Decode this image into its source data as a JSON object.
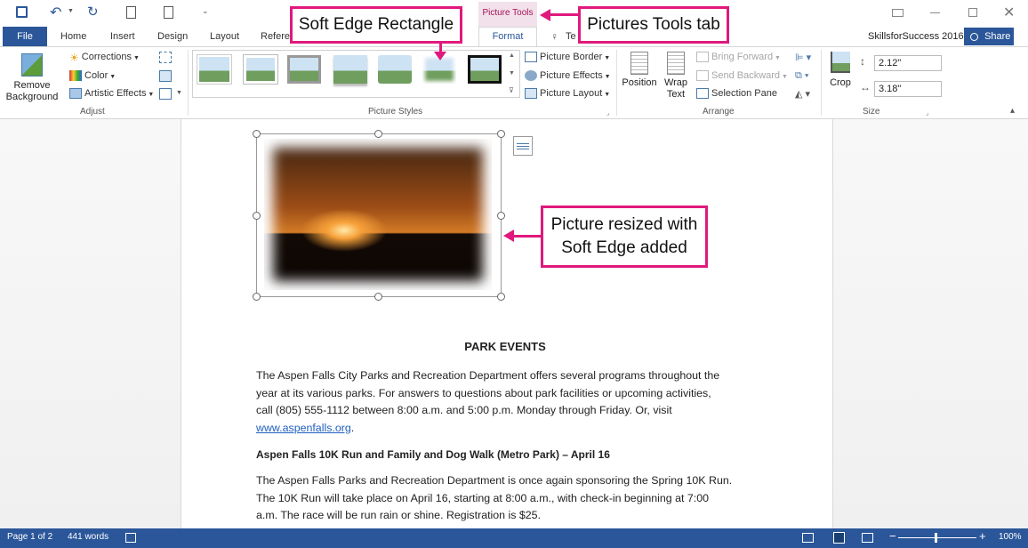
{
  "titlebar": {
    "account": "SkillsforSuccess 2016",
    "share": "Share"
  },
  "tabs": {
    "file": "File",
    "home": "Home",
    "insert": "Insert",
    "design": "Design",
    "layout": "Layout",
    "references": "Refere",
    "format": "Format",
    "tell": "Te",
    "picture_tools": "Picture Tools"
  },
  "ribbon": {
    "adjust": {
      "remove_background_1": "Remove",
      "remove_background_2": "Background",
      "corrections": "Corrections",
      "color": "Color",
      "artistic_effects": "Artistic Effects",
      "label": "Adjust"
    },
    "picture_styles": {
      "border": "Picture Border",
      "effects": "Picture Effects",
      "layout": "Picture Layout",
      "label": "Picture Styles"
    },
    "arrange": {
      "position": "Position",
      "wrap_text_1": "Wrap",
      "wrap_text_2": "Text",
      "bring_forward": "Bring Forward",
      "send_backward": "Send Backward",
      "selection_pane": "Selection Pane",
      "label": "Arrange"
    },
    "size": {
      "crop": "Crop",
      "height": "2.12\"",
      "width": "3.18\"",
      "label": "Size"
    }
  },
  "callouts": {
    "soft_edge": "Soft Edge Rectangle",
    "pictures_tools": "Pictures Tools tab",
    "resized_1": "Picture resized with",
    "resized_2": "Soft Edge added"
  },
  "document": {
    "heading": "PARK EVENTS",
    "para1_l1": "The Aspen Falls City Parks and Recreation Department offers several programs throughout the",
    "para1_l2": "year at its various parks. For answers to questions about park facilities or upcoming activities,",
    "para1_l3": "call (805) 555-1112 between 8:00 a.m. and 5:00 p.m. Monday through Friday. Or, visit",
    "link": "www.aspenfalls.org",
    "link_after": ".",
    "subheading": "Aspen Falls 10K Run and Family and Dog Walk (Metro Park) – April 16",
    "para2_l1": "The Aspen Falls Parks and Recreation Department is once again sponsoring the Spring 10K Run.",
    "para2_l2": "The 10K Run will take place on April 16, starting at 8:00 a.m., with check-in beginning at 7:00",
    "para2_l3": "a.m. The race will be run rain or shine. Registration is $25."
  },
  "status": {
    "page": "Page 1 of 2",
    "words": "441 words",
    "zoom": "100%"
  },
  "colors": {
    "accent": "#2b579a",
    "callout": "#e0197d",
    "picture_tools": "#a4135a"
  }
}
